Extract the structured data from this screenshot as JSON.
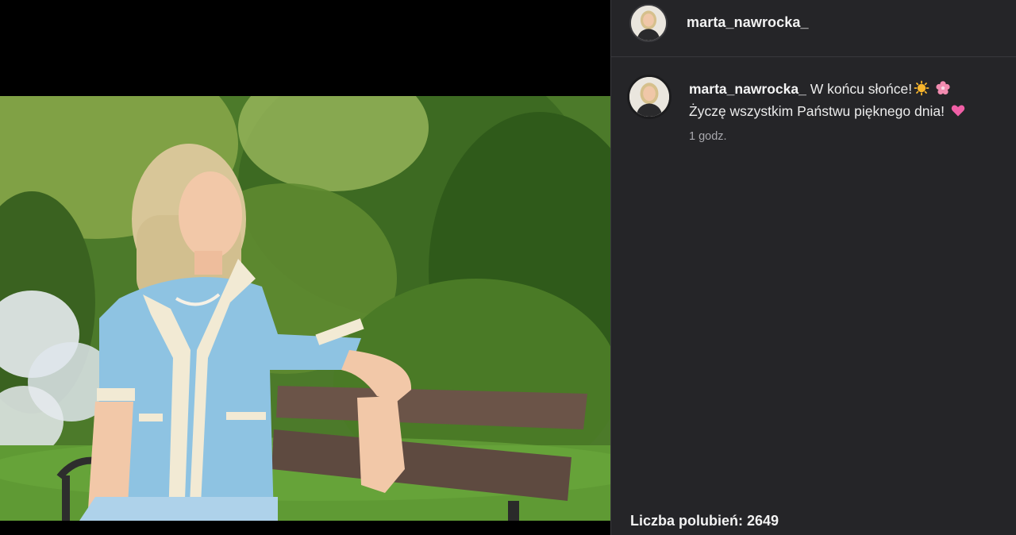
{
  "post": {
    "username": "marta_nawrocka_",
    "caption_username": "marta_nawrocka_",
    "caption_line1": "W końcu słońce!",
    "caption_line2": "Życzę wszystkim Państwu pięknego dnia!",
    "time_ago": "1 godz.",
    "likes_text": "Liczba polubień: 2649"
  },
  "emojis": {
    "sun": "sun-emoji",
    "flower": "cherry-blossom-emoji",
    "heart": "pink-heart-emoji"
  },
  "colors": {
    "sidebar_bg": "#252528",
    "text_primary": "#f2f2f2",
    "text_secondary": "#a9a9ae"
  }
}
